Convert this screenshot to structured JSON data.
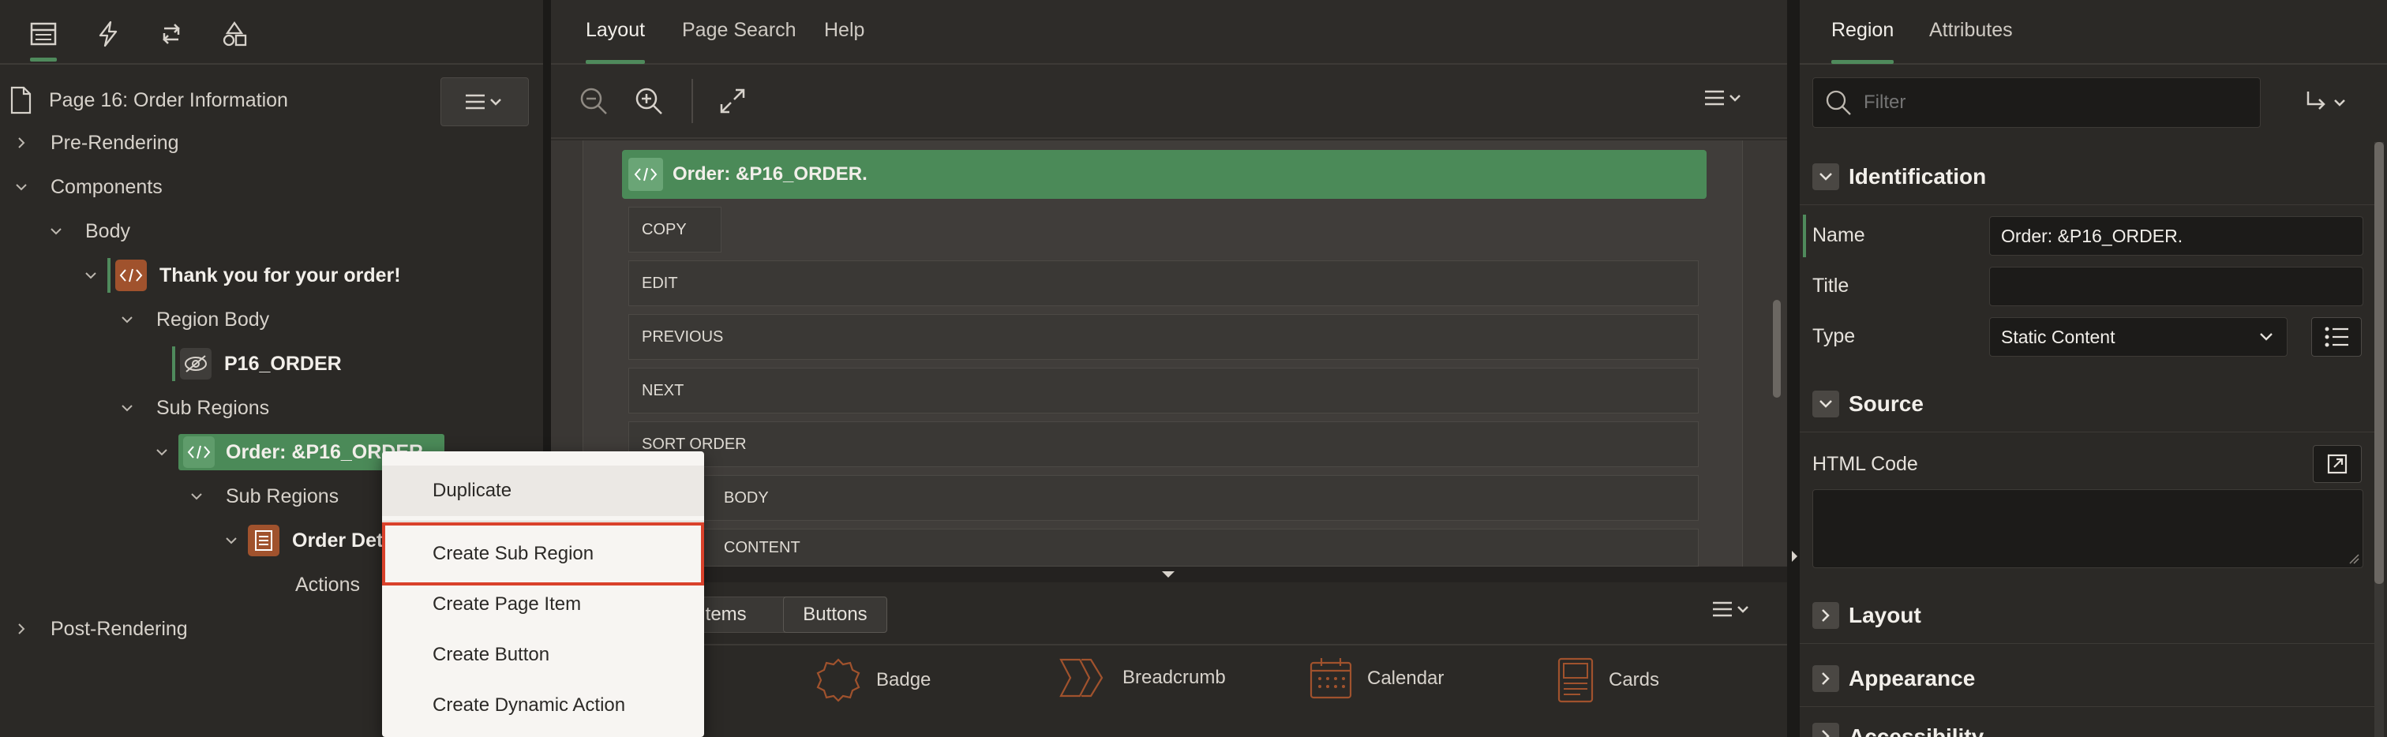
{
  "left_panel": {
    "tabs": [
      {
        "icon": "rendering-tree-icon",
        "active": true
      },
      {
        "icon": "dynamic-actions-icon"
      },
      {
        "icon": "processing-icon"
      },
      {
        "icon": "shared-components-icon"
      }
    ],
    "page_title": "Page 16: Order Information",
    "tree": {
      "pre_rendering": "Pre-Rendering",
      "components": "Components",
      "body": "Body",
      "thank_you": "Thank you for your order!",
      "region_body": "Region Body",
      "item": "P16_ORDER",
      "sub_regions": "Sub Regions",
      "order_region": "Order: &P16_ORDER.",
      "sub_regions_2": "Sub Regions",
      "order_details": "Order Details",
      "actions": "Actions",
      "post_rendering": "Post-Rendering"
    }
  },
  "context_menu": {
    "items": [
      "Duplicate",
      "Create Sub Region",
      "Create Page Item",
      "Create Button",
      "Create Dynamic Action"
    ],
    "highlighted_index": 1
  },
  "center_panel": {
    "tabs": [
      "Layout",
      "Page Search",
      "Help"
    ],
    "region_title": "Order: &P16_ORDER.",
    "button_positions": [
      "COPY",
      "EDIT",
      "PREVIOUS",
      "NEXT",
      "SORT ORDER",
      "BODY",
      "CONTENT"
    ],
    "gallery_tabs": [
      "Items",
      "Buttons"
    ],
    "gallery_items": [
      "Badge",
      "Breadcrumb",
      "Calendar",
      "Cards"
    ]
  },
  "right_panel": {
    "tabs": [
      "Region",
      "Attributes"
    ],
    "filter_placeholder": "Filter",
    "sections": {
      "identification": "Identification",
      "source": "Source",
      "layout": "Layout",
      "appearance": "Appearance",
      "accessibility": "Accessibility"
    },
    "fields": {
      "name_label": "Name",
      "name_value": "Order: &P16_ORDER.",
      "title_label": "Title",
      "title_value": "",
      "type_label": "Type",
      "type_value": "Static Content",
      "html_code_label": "HTML Code"
    }
  },
  "colors": {
    "accent_green": "#4f8a5c",
    "region_green": "#4b8a58",
    "highlight_red": "#d9412b"
  }
}
